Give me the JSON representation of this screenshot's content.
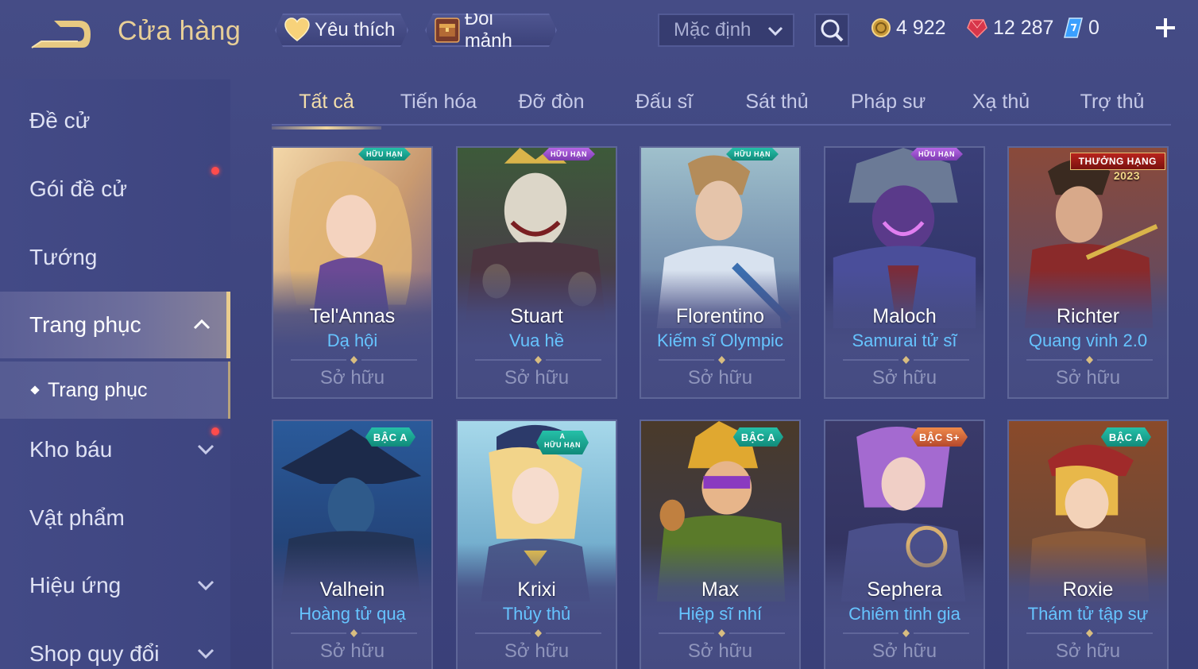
{
  "header": {
    "title": "Cửa hàng",
    "favorite_label": "Yêu thích",
    "exchange_label": "Đổi mảnh",
    "sort_value": "Mặc định",
    "currencies": {
      "gold": "4 922",
      "ruby": "12 287",
      "voucher": "0"
    }
  },
  "sidebar": {
    "items": [
      {
        "label": "Đề cử"
      },
      {
        "label": "Gói đề cử"
      },
      {
        "label": "Tướng"
      },
      {
        "label": "Trang phục"
      },
      {
        "label": "Kho báu"
      },
      {
        "label": "Vật phẩm"
      },
      {
        "label": "Hiệu ứng"
      },
      {
        "label": "Shop quy đổi"
      }
    ],
    "sub_item": "Trang phục"
  },
  "tabs": [
    {
      "label": "Tất cả"
    },
    {
      "label": "Tiến hóa"
    },
    {
      "label": "Đỡ đòn"
    },
    {
      "label": "Đấu sĩ"
    },
    {
      "label": "Sát thủ"
    },
    {
      "label": "Pháp sư"
    },
    {
      "label": "Xạ thủ"
    },
    {
      "label": "Trợ thủ"
    }
  ],
  "colors": {
    "accent_gold": "#e8cf97",
    "skin_blue": "#66c4ff",
    "background": "#3f4680",
    "notification": "#ff4c4c"
  },
  "cards": [
    {
      "hero": "Tel'Annas",
      "skin": "Dạ hội",
      "status": "Sở hữu",
      "badge": "HỮU HẠN"
    },
    {
      "hero": "Stuart",
      "skin": "Vua hề",
      "status": "Sở hữu",
      "badge": "HỮU HẠN"
    },
    {
      "hero": "Florentino",
      "skin": "Kiếm sĩ Olympic",
      "status": "Sở hữu",
      "badge": "HỮU HẠN"
    },
    {
      "hero": "Maloch",
      "skin": "Samurai tử sĩ",
      "status": "Sở hữu",
      "badge": "HỮU HẠN"
    },
    {
      "hero": "Richter",
      "skin": "Quang vinh 2.0",
      "status": "Sở hữu",
      "badge": "THƯỞNG HẠNG",
      "badge_year": "2023"
    },
    {
      "hero": "Valhein",
      "skin": "Hoàng tử quạ",
      "status": "Sở hữu",
      "badge": "BẬC A"
    },
    {
      "hero": "Krixi",
      "skin": "Thủy thủ",
      "status": "Sở hữu",
      "badge": "A",
      "badge_sub": "HỮU HẠN"
    },
    {
      "hero": "Max",
      "skin": "Hiệp sĩ nhí",
      "status": "Sở hữu",
      "badge": "BẬC A"
    },
    {
      "hero": "Sephera",
      "skin": "Chiêm tinh gia",
      "status": "Sở hữu",
      "badge": "BẬC S+"
    },
    {
      "hero": "Roxie",
      "skin": "Thám tử tập sự",
      "status": "Sở hữu",
      "badge": "BẬC A"
    }
  ]
}
